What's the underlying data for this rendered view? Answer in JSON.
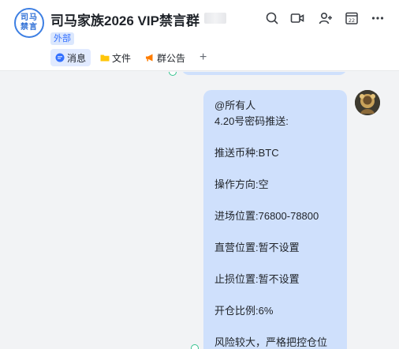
{
  "header": {
    "avatar_text": [
      "司马",
      "禁言"
    ],
    "title": "司马家族2026 VIP禁言群",
    "badge": "外部",
    "icons": [
      "search-icon",
      "video-icon",
      "add-member-icon",
      "calendar-icon",
      "more-icon"
    ],
    "calendar_day": "22"
  },
  "tabs": [
    {
      "label": "消息",
      "icon": "message-icon",
      "active": true
    },
    {
      "label": "文件",
      "icon": "folder-icon",
      "active": false
    },
    {
      "label": "群公告",
      "icon": "announcement-icon",
      "active": false
    }
  ],
  "tab_add": "+",
  "message": {
    "lines": [
      "@所有人",
      "4.20号密码推送:",
      "",
      "推送币种:BTC",
      "",
      "操作方向:空",
      "",
      "进场位置:76800-78800",
      "",
      "直营位置:暂不设置",
      "",
      "止损位置:暂不设置",
      "",
      "开仓比例:6%",
      "",
      "风险较大，严格把控仓位"
    ]
  },
  "colors": {
    "accent": "#3370ff",
    "bubble": "#cfe0fc",
    "read_dot": "#34c38f"
  }
}
